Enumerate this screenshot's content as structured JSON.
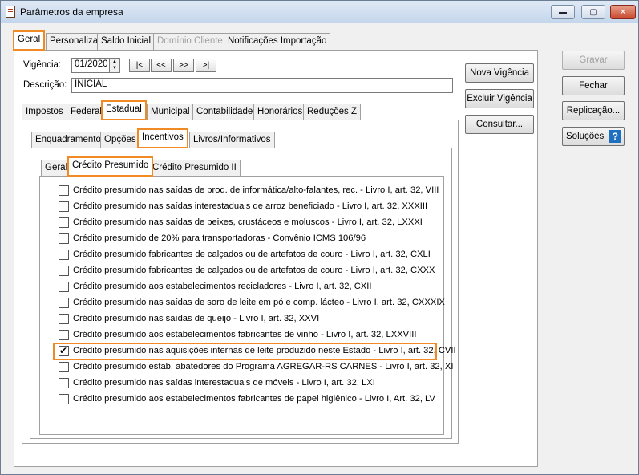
{
  "window": {
    "title": "Parâmetros da empresa",
    "minimize": "▬",
    "maximize": "▢",
    "close": "✕"
  },
  "main_tabs": [
    {
      "label": "Geral",
      "active": true
    },
    {
      "label": "Personaliza"
    },
    {
      "label": "Saldo Inicial"
    },
    {
      "label": "Domínio Cliente",
      "disabled": true
    },
    {
      "label": "Notificações Importação"
    }
  ],
  "form": {
    "vigencia_label": "Vigência:",
    "vigencia_value": "01/2020",
    "nav_first": "|<",
    "nav_prev": "<<",
    "nav_next": ">>",
    "nav_last": ">|",
    "descricao_label": "Descrição:",
    "descricao_value": "INICIAL"
  },
  "mid_buttons": {
    "nova": "Nova Vigência",
    "excluir": "Excluir Vigência",
    "consultar": "Consultar..."
  },
  "side_buttons": {
    "gravar": "Gravar",
    "fechar": "Fechar",
    "replicacao": "Replicação...",
    "solucoes": "Soluções",
    "help_icon": "?"
  },
  "level2_tabs": [
    {
      "label": "Impostos"
    },
    {
      "label": "Federal"
    },
    {
      "label": "Estadual",
      "active": true
    },
    {
      "label": "Municipal"
    },
    {
      "label": "Contabilidade"
    },
    {
      "label": "Honorários"
    },
    {
      "label": "Reduções Z"
    }
  ],
  "level3_tabs": [
    {
      "label": "Enquadramento"
    },
    {
      "label": "Opções"
    },
    {
      "label": "Incentivos",
      "active": true
    },
    {
      "label": "Livros/Informativos"
    }
  ],
  "level4_tabs": [
    {
      "label": "Geral"
    },
    {
      "label": "Crédito Presumido",
      "active": true
    },
    {
      "label": "Crédito Presumido II"
    }
  ],
  "credits": [
    {
      "label": "Crédito presumido nas saídas de prod. de informática/alto-falantes, rec. - Livro I, art. 32, VIII",
      "checked": false
    },
    {
      "label": "Crédito presumido nas saídas interestaduais de arroz beneficiado - Livro I, art. 32, XXXIII",
      "checked": false
    },
    {
      "label": "Crédito presumido nas saídas de peixes, crustáceos e moluscos - Livro I, art. 32, LXXXI",
      "checked": false
    },
    {
      "label": "Crédito presumido de 20% para transportadoras - Convênio ICMS 106/96",
      "checked": false
    },
    {
      "label": "Crédito presumido fabricantes de calçados ou de artefatos de couro - Livro I, art. 32, CXLI",
      "checked": false
    },
    {
      "label": "Crédito presumido fabricantes de calçados ou de artefatos de couro - Livro I, art. 32, CXXX",
      "checked": false
    },
    {
      "label": "Crédito presumido aos estabelecimentos recicladores - Livro I, art. 32, CXII",
      "checked": false
    },
    {
      "label": "Crédito presumido nas saídas de soro de leite em pó e comp. lácteo - Livro I, art. 32, CXXXIX",
      "checked": false
    },
    {
      "label": "Crédito presumido nas saídas de queijo - Livro I, art. 32, XXVI",
      "checked": false
    },
    {
      "label": "Crédito presumido aos estabelecimentos fabricantes de vinho - Livro I, art. 32, LXXVIII",
      "checked": false
    },
    {
      "label": "Crédito presumido nas aquisições internas de leite produzido neste Estado - Livro I, art. 32, CVII",
      "checked": true
    },
    {
      "label": "Crédito presumido estab. abatedores do Programa AGREGAR-RS CARNES - Livro I, art. 32, XI",
      "checked": false
    },
    {
      "label": "Crédito presumido nas saídas interestaduais de móveis - Livro I, art. 32, LXI",
      "checked": false
    },
    {
      "label": "Crédito presumido aos estabelecimentos fabricantes de papel higiênico - Livro I, Art. 32, LV",
      "checked": false
    }
  ]
}
